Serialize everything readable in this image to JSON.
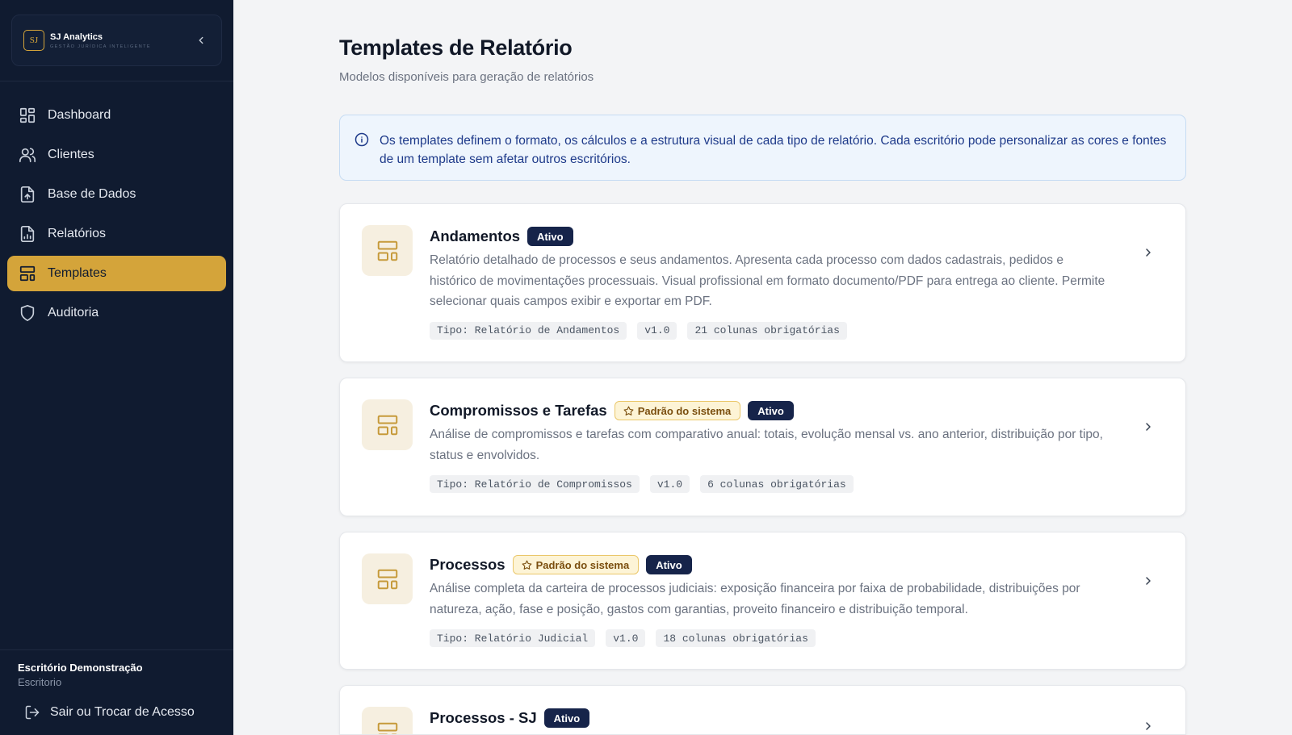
{
  "brand": {
    "logo_text": "SJ",
    "name": "SJ Analytics",
    "tagline": "GESTÃO JURÍDICA INTELIGENTE"
  },
  "nav": {
    "items": [
      {
        "label": "Dashboard",
        "icon": "dashboard-icon"
      },
      {
        "label": "Clientes",
        "icon": "users-icon"
      },
      {
        "label": "Base de Dados",
        "icon": "file-upload-icon"
      },
      {
        "label": "Relatórios",
        "icon": "file-chart-icon"
      },
      {
        "label": "Templates",
        "icon": "layout-template-icon",
        "active": true
      },
      {
        "label": "Auditoria",
        "icon": "shield-icon"
      }
    ]
  },
  "footer": {
    "org_name": "Escritório Demonstração",
    "org_type": "Escritorio",
    "logout_label": "Sair ou Trocar de Acesso"
  },
  "page": {
    "title": "Templates de Relatório",
    "subtitle": "Modelos disponíveis para geração de relatórios"
  },
  "info": {
    "text": "Os templates definem o formato, os cálculos e a estrutura visual de cada tipo de relatório. Cada escritório pode personalizar as cores e fontes de um template sem afetar outros escritórios."
  },
  "badges": {
    "active": "Ativo",
    "default": "Padrão do sistema"
  },
  "templates": [
    {
      "title": "Andamentos",
      "description": "Relatório detalhado de processos e seus andamentos. Apresenta cada processo com dados cadastrais, pedidos e histórico de movimentações processuais. Visual profissional em formato documento/PDF para entrega ao cliente. Permite selecionar quais campos exibir e exportar em PDF.",
      "tags": [
        "Tipo: Relatório de Andamentos",
        "v1.0",
        "21 colunas obrigatórias"
      ]
    },
    {
      "title": "Compromissos e Tarefas",
      "description": "Análise de compromissos e tarefas com comparativo anual: totais, evolução mensal vs. ano anterior, distribuição por tipo, status e envolvidos.",
      "tags": [
        "Tipo: Relatório de Compromissos",
        "v1.0",
        "6 colunas obrigatórias"
      ]
    },
    {
      "title": "Processos",
      "description": "Análise completa da carteira de processos judiciais: exposição financeira por faixa de probabilidade, distribuições por natureza, ação, fase e posição, gastos com garantias, proveito financeiro e distribuição temporal.",
      "tags": [
        "Tipo: Relatório Judicial",
        "v1.0",
        "18 colunas obrigatórias"
      ]
    },
    {
      "title": "Processos - SJ"
    }
  ],
  "colors": {
    "sidebar_bg": "#101b30",
    "accent": "#d4a43a",
    "badge_active": "#16244a",
    "info_bg": "#eef5fd"
  }
}
